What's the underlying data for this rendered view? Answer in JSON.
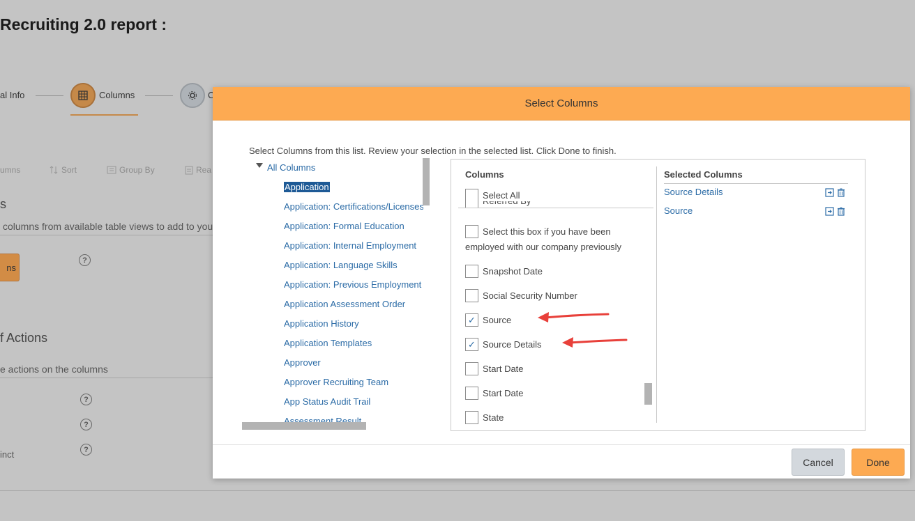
{
  "page": {
    "title": "Recruiting 2.0 report :",
    "steps": [
      {
        "label": "al Info"
      },
      {
        "label": "Columns"
      },
      {
        "label": "C"
      }
    ],
    "toolbar": [
      "umns",
      "Sort",
      "Group By",
      "Rea"
    ],
    "section1_heading": "s",
    "section1_desc": "columns from available table views to add to you",
    "add_btn_label": "ns",
    "section2_heading": "f Actions",
    "section2_desc": "e actions on the columns",
    "distinct_label": "inct",
    "help_glyph": "?"
  },
  "modal": {
    "title": "Select Columns",
    "instructions": "Select Columns from this list. Review your selection in the selected list. Click Done to finish.",
    "tree": {
      "root": "All Columns",
      "items": [
        "Application",
        "Application: Certifications/Licenses",
        "Application: Formal Education",
        "Application: Internal Employment",
        "Application: Language Skills",
        "Application: Previous Employment",
        "Application Assessment Order",
        "Application History",
        "Application Templates",
        "Approver",
        "Approver Recruiting Team",
        "App Status Audit Trail",
        "Assessment Result"
      ],
      "selected_index": 0
    },
    "columns": {
      "header": "Columns",
      "select_all": "Select All",
      "items": [
        {
          "label": "Referred By",
          "checked": false
        },
        {
          "label": "Select this box if you have been",
          "label2": "employed with our company previously",
          "checked": false
        },
        {
          "label": "Snapshot Date",
          "checked": false
        },
        {
          "label": "Social Security Number",
          "checked": false
        },
        {
          "label": "Source",
          "checked": true
        },
        {
          "label": "Source Details",
          "checked": true
        },
        {
          "label": "Start Date",
          "checked": false
        },
        {
          "label": "Start Date",
          "checked": false
        },
        {
          "label": "State",
          "checked": false
        }
      ],
      "check_glyph": "✓"
    },
    "selected": {
      "header": "Selected Columns",
      "items": [
        "Source Details",
        "Source"
      ]
    },
    "buttons": {
      "cancel": "Cancel",
      "done": "Done"
    }
  },
  "colors": {
    "accent": "#fdaa52",
    "link": "#2b6ba6",
    "annotation_arrow": "#e8403a"
  }
}
